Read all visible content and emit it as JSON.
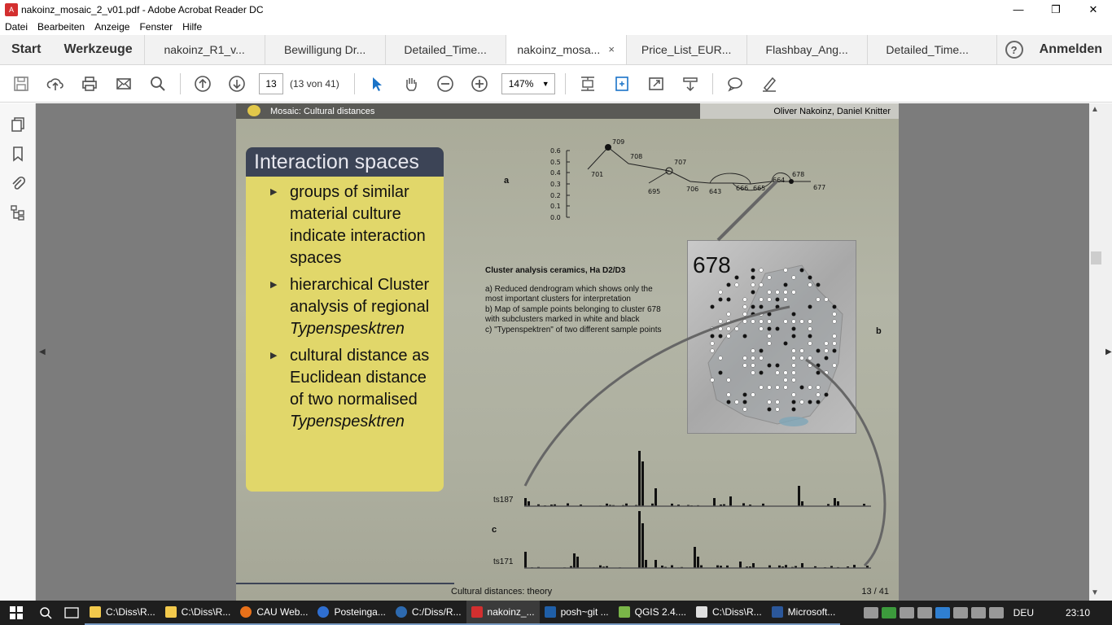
{
  "window": {
    "title": "nakoinz_mosaic_2_v01.pdf - Adobe Acrobat Reader DC",
    "minimize": "—",
    "maximize": "❐",
    "close": "✕"
  },
  "menu": [
    "Datei",
    "Bearbeiten",
    "Anzeige",
    "Fenster",
    "Hilfe"
  ],
  "tabbar": {
    "start": "Start",
    "tools": "Werkzeuge",
    "tabs": [
      {
        "label": "nakoinz_R1_v..."
      },
      {
        "label": "Bewilligung Dr..."
      },
      {
        "label": "Detailed_Time..."
      },
      {
        "label": "nakoinz_mosa...",
        "active": true
      },
      {
        "label": "Price_List_EUR..."
      },
      {
        "label": "Flashbay_Ang..."
      },
      {
        "label": "Detailed_Time..."
      }
    ],
    "close_glyph": "×",
    "help": "?",
    "login": "Anmelden"
  },
  "toolbar": {
    "page_current": "13",
    "page_count": "(13 von 41)",
    "zoom": "147%"
  },
  "slide": {
    "header_left": "Mosaic: Cultural distances",
    "header_right": "Oliver Nakoinz, Daniel Knitter",
    "box_title": "Interaction spaces",
    "bullets": [
      {
        "text": "groups of similar material culture indicate interaction spaces",
        "italic": ""
      },
      {
        "text": "hierarchical Cluster analysis of regional",
        "italic": "Typenspesktren"
      },
      {
        "text": "cultural distance as Euclidean distance of two normalised",
        "italic": "Typenspesktren"
      }
    ],
    "caption_title": "Cluster analysis ceramics, Ha D2/D3",
    "caption_lines": [
      "a) Reduced dendrogram which shows only the",
      "most important clusters for interpretation",
      "b) Map of sample points belonging to cluster 678",
      "with subclusters marked in white and black",
      "c) \"Typenspektren\" of two different sample points"
    ],
    "label_a": "a",
    "label_b": "b",
    "label_c": "c",
    "map_number": "678",
    "ts_top": "ts187",
    "ts_bottom": "ts171",
    "footer_title": "Cultural distances: theory",
    "footer_page": "13 / 41",
    "dendro_yticks": [
      "0.6",
      "0.5",
      "0.4",
      "0.3",
      "0.2",
      "0.1",
      "0.0"
    ],
    "dendro_nodes": [
      "709",
      "708",
      "701",
      "707",
      "695",
      "706",
      "643",
      "666",
      "665",
      "664",
      "678",
      "677"
    ]
  },
  "taskbar": {
    "items": [
      {
        "label": "C:\\Diss\\R...",
        "color": "#f2c94c"
      },
      {
        "label": "C:\\Diss\\R...",
        "color": "#f2c94c"
      },
      {
        "label": "CAU Web...",
        "color": "#e8711a"
      },
      {
        "label": "Posteinga...",
        "color": "#2f6fd1"
      },
      {
        "label": "C:/Diss/R...",
        "color": "#2d6ab0"
      },
      {
        "label": "nakoinz_...",
        "color": "#d32f2f",
        "active": true
      },
      {
        "label": "posh~git ...",
        "color": "#1f5fa8"
      },
      {
        "label": "QGIS 2.4....",
        "color": "#7ab648"
      },
      {
        "label": "C:\\Diss\\R...",
        "color": "#e0e0e0"
      },
      {
        "label": "Microsoft...",
        "color": "#2b579a"
      }
    ],
    "lang": "DEU",
    "time": "23:10"
  }
}
